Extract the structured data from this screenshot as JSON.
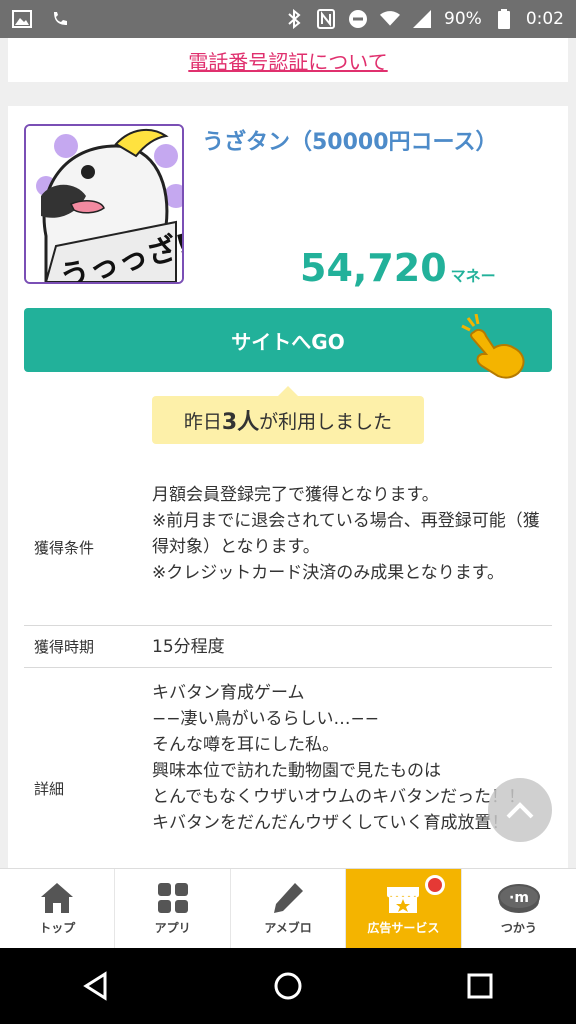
{
  "status_bar": {
    "battery": "90%",
    "time": "0:02"
  },
  "phone_verify_link": "電話番号認証について",
  "offer": {
    "title": "うざタン（50000円コース）",
    "image_text": "うっっざ!!",
    "price_value": "54,720",
    "price_unit": "マネー",
    "go_button": "サイトへGO",
    "usage_prefix": "昨日",
    "usage_count": "3人",
    "usage_suffix": "が利用しました"
  },
  "info_rows": [
    {
      "label": "獲得条件",
      "value": "月額会員登録完了で獲得となります。\n※前月までに退会されている場合、再登録可能（獲得対象）となります。\n※クレジットカード決済のみ成果となります。"
    },
    {
      "label": "獲得時期",
      "value": "15分程度"
    },
    {
      "label": "詳細",
      "value": "キバタン育成ゲーム\n−−凄い鳥がいるらしい…−−\nそんな噂を耳にした私。\n興味本位で訪れた動物園で見たものは\nとんでもなくウザいオウムのキバタンだった！！\nキバタンをだんだんウザくしていく育成放置！"
    }
  ],
  "bottom_nav": [
    {
      "label": "トップ",
      "icon": "home-icon"
    },
    {
      "label": "アプリ",
      "icon": "apps-grid-icon"
    },
    {
      "label": "アメブロ",
      "icon": "pencil-icon"
    },
    {
      "label": "広告サービス",
      "icon": "store-icon",
      "active": true
    },
    {
      "label": "つかう",
      "icon": "money-coin-icon"
    }
  ],
  "colors": {
    "accent_green": "#22b19a",
    "active_tab": "#f4b400",
    "link_pink": "#e0306e",
    "title_blue": "#4d8bc9"
  }
}
